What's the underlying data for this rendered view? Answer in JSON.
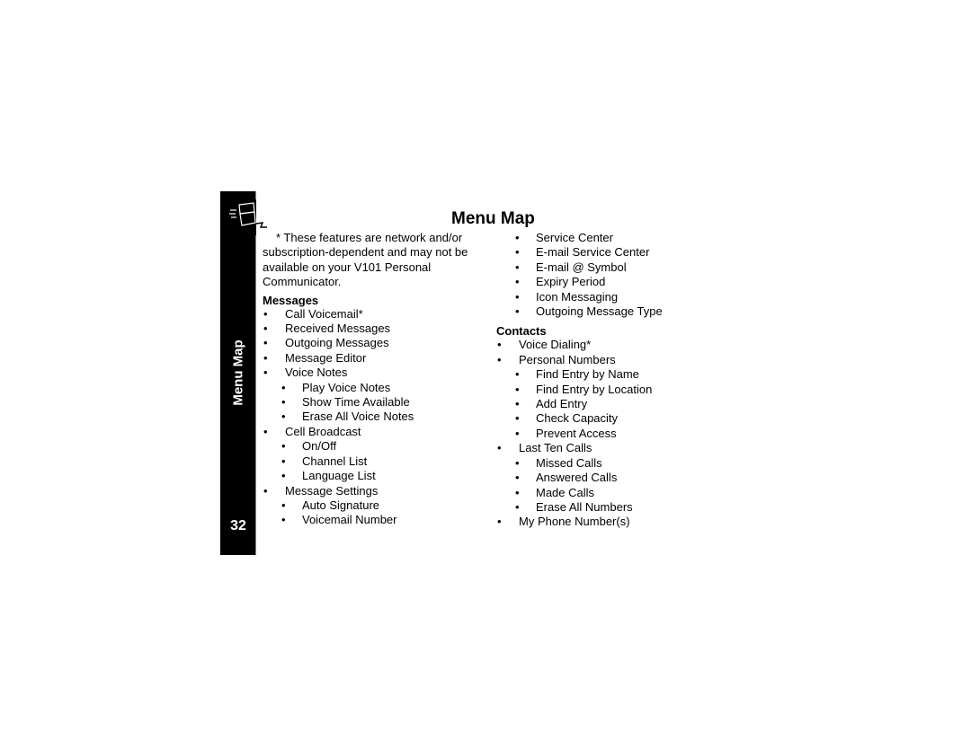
{
  "page": {
    "title": "Menu Map",
    "side_tab_label": "Menu Map",
    "page_number": "32",
    "icon": "phone-communicator-icon"
  },
  "note": {
    "text_line1": "*  These features are network and/or",
    "text_rest": "subscription-dependent and may not be available on your V101 Personal Communicator."
  },
  "messages": {
    "heading": "Messages",
    "items": [
      {
        "label": "Call Voicemail*",
        "level": 1
      },
      {
        "label": "Received Messages",
        "level": 1
      },
      {
        "label": "Outgoing Messages",
        "level": 1
      },
      {
        "label": "Message Editor",
        "level": 1
      },
      {
        "label": "Voice Notes",
        "level": 1
      },
      {
        "label": "Play Voice Notes",
        "level": 2
      },
      {
        "label": "Show Time Available",
        "level": 2
      },
      {
        "label": "Erase All Voice Notes",
        "level": 2
      },
      {
        "label": "Cell Broadcast",
        "level": 1
      },
      {
        "label": "On/Off",
        "level": 2
      },
      {
        "label": "Channel List",
        "level": 2
      },
      {
        "label": "Language List",
        "level": 2
      },
      {
        "label": "Message Settings",
        "level": 1
      },
      {
        "label": "Auto Signature",
        "level": 2
      },
      {
        "label": "Voicemail Number",
        "level": 2
      }
    ],
    "continued": [
      {
        "label": "Service Center",
        "level": 2
      },
      {
        "label": "E-mail Service Center",
        "level": 2
      },
      {
        "label": "E-mail @ Symbol",
        "level": 2
      },
      {
        "label": "Expiry Period",
        "level": 2
      },
      {
        "label": "Icon Messaging",
        "level": 2
      },
      {
        "label": "Outgoing Message Type",
        "level": 2
      }
    ]
  },
  "contacts": {
    "heading": "Contacts",
    "items": [
      {
        "label": "Voice Dialing*",
        "level": 1
      },
      {
        "label": "Personal Numbers",
        "level": 1
      },
      {
        "label": "Find Entry by Name",
        "level": 2
      },
      {
        "label": "Find Entry by Location",
        "level": 2
      },
      {
        "label": "Add Entry",
        "level": 2
      },
      {
        "label": "Check Capacity",
        "level": 2
      },
      {
        "label": "Prevent Access",
        "level": 2
      },
      {
        "label": "Last Ten Calls",
        "level": 1
      },
      {
        "label": "Missed Calls",
        "level": 2
      },
      {
        "label": "Answered Calls",
        "level": 2
      },
      {
        "label": "Made Calls",
        "level": 2
      },
      {
        "label": "Erase All Numbers",
        "level": 2
      },
      {
        "label": "My Phone Number(s)",
        "level": 1
      }
    ]
  }
}
